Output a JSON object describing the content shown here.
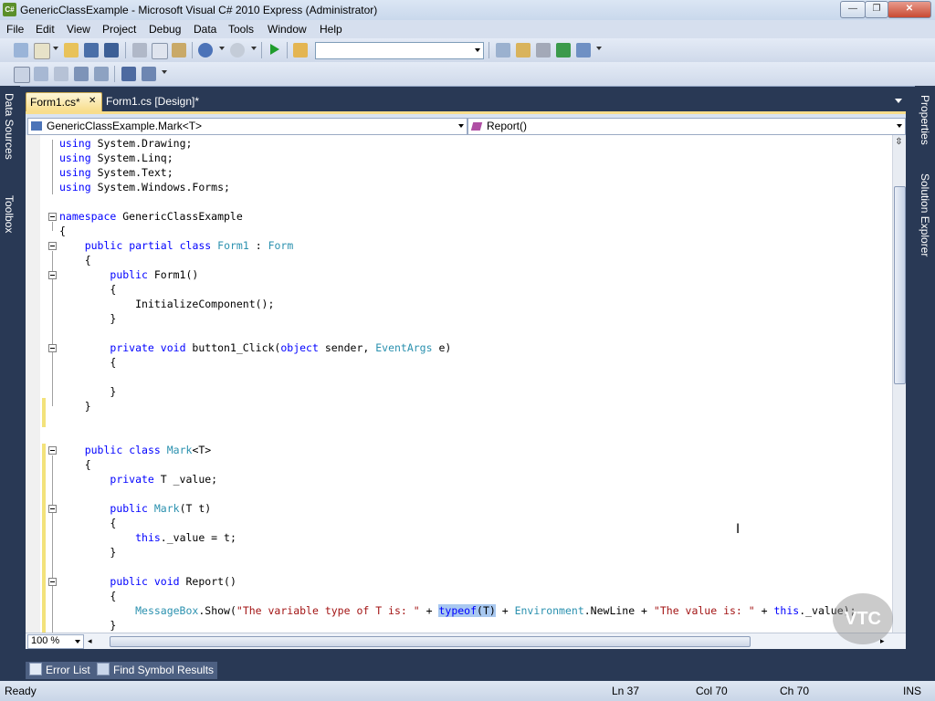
{
  "window": {
    "title": "GenericClassExample - Microsoft Visual C# 2010 Express (Administrator)",
    "icon_label": "C#",
    "minimize_glyph": "—",
    "maximize_glyph": "❐",
    "close_glyph": "✕"
  },
  "menu": [
    "File",
    "Edit",
    "View",
    "Project",
    "Debug",
    "Data",
    "Tools",
    "Window",
    "Help"
  ],
  "left_rail": {
    "tabs": [
      "Data Sources",
      "Toolbox"
    ]
  },
  "right_rail": {
    "tabs": [
      "Properties",
      "Solution Explorer"
    ]
  },
  "tabs": [
    {
      "label": "Form1.cs*",
      "close": "✕"
    },
    {
      "label": "Form1.cs [Design]*"
    }
  ],
  "navbar": {
    "type_selector": "GenericClassExample.Mark<T>",
    "member_selector": "Report()"
  },
  "code": {
    "lines": [
      "using System.Drawing;",
      "using System.Linq;",
      "using System.Text;",
      "using System.Windows.Forms;",
      "",
      "namespace GenericClassExample",
      "{",
      "    public partial class Form1 : Form",
      "    {",
      "        public Form1()",
      "        {",
      "            InitializeComponent();",
      "        }",
      "",
      "        private void button1_Click(object sender, EventArgs e)",
      "        {",
      "",
      "        }",
      "    }",
      "",
      "",
      "    public class Mark<T>",
      "    {",
      "        private T _value;",
      "",
      "        public Mark(T t)",
      "        {",
      "            this._value = t;",
      "        }",
      "",
      "        public void Report()",
      "        {",
      "            MessageBox.Show(\"The variable type of T is: \" + typeof(T) + Environment.NewLine + \"The value is: \" + this._value);",
      "        }"
    ]
  },
  "zoom": "100 %",
  "bottom_tabs": [
    "Error List",
    "Find Symbol Results"
  ],
  "status": {
    "state": "Ready",
    "line": "Ln 37",
    "col": "Col 70",
    "ch": "Ch 70",
    "mode": "INS"
  },
  "watermark": "VTC",
  "colors": {
    "keyword": "#0000ff",
    "type": "#2b91af",
    "string": "#a31515",
    "active_tab": "#f8dd8b",
    "chrome": "#293955"
  }
}
